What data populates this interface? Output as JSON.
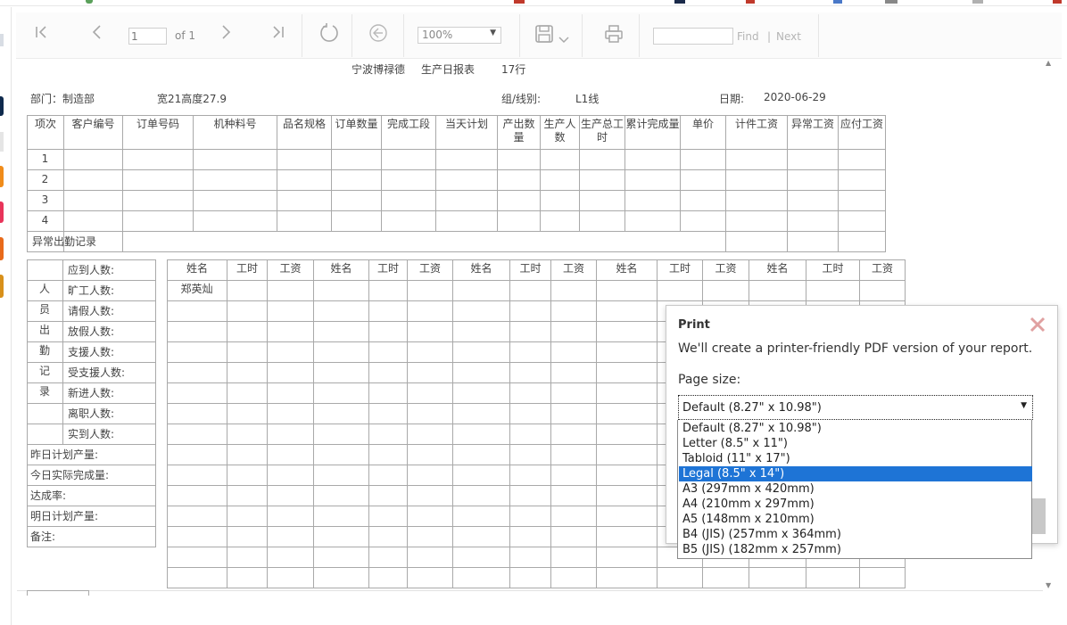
{
  "toolbar": {
    "page_value": "1",
    "page_of": "of 1",
    "zoom": "100%",
    "find": "Find",
    "next": "Next"
  },
  "report": {
    "company": "宁波博禄德",
    "title": "生产日报表",
    "rows_label": "17行",
    "department": "部门：制造部",
    "dimensions": "宽21高度27.9",
    "line_label": "组/线别:",
    "line_value": "L1线",
    "date_label": "日期:",
    "date_value": "2020-06-29"
  },
  "production_table": {
    "headers": [
      "项次",
      "客户编号",
      "订单号码",
      "机种料号",
      "品名规格",
      "订单数量",
      "完成工段",
      "当天计划",
      "产出数量",
      "生产人数",
      "生产总工时",
      "累计完成量",
      "单价",
      "计件工资",
      "异常工资",
      "应付工资"
    ],
    "row_numbers": [
      "1",
      "2",
      "3",
      "4"
    ],
    "abnormal_label": "异常出勤记录"
  },
  "attendance_table": {
    "section_chars": [
      "人",
      "员",
      "出",
      "勤",
      "记",
      "录"
    ],
    "personnel_rows": [
      "应到人数:",
      "旷工人数:",
      "请假人数:",
      "放假人数:",
      "支援人数:",
      "受支援人数:",
      "新进人数:",
      "离职人数:",
      "实到人数:"
    ],
    "summary_rows": [
      "昨日计划产量:",
      "今日实际完成量:",
      "达成率:",
      "明日计划产量:",
      "备注:"
    ]
  },
  "employee_table": {
    "headers": [
      "姓名",
      "工时",
      "工资",
      "姓名",
      "工时",
      "工资",
      "姓名",
      "工时",
      "工资",
      "姓名",
      "工时",
      "工资",
      "姓名",
      "工时",
      "工资"
    ],
    "first_name": "郑英灿"
  },
  "print_dialog": {
    "title": "Print",
    "description": "We'll create a printer-friendly PDF version of your report.",
    "page_size_label": "Page size:",
    "selected": "Default (8.27\" x 10.98\")",
    "highlighted": "Legal (8.5\" x 14\")",
    "options": [
      "Default (8.27\" x 10.98\")",
      "Letter (8.5\" x 11\")",
      "Tabloid (11\" x 17\")",
      "Legal (8.5\" x 14\")",
      "A3 (297mm x 420mm)",
      "A4 (210mm x 297mm)",
      "A5 (148mm x 210mm)",
      "B4 (JIS) (257mm x 364mm)",
      "B5 (JIS) (182mm x 257mm)"
    ]
  }
}
